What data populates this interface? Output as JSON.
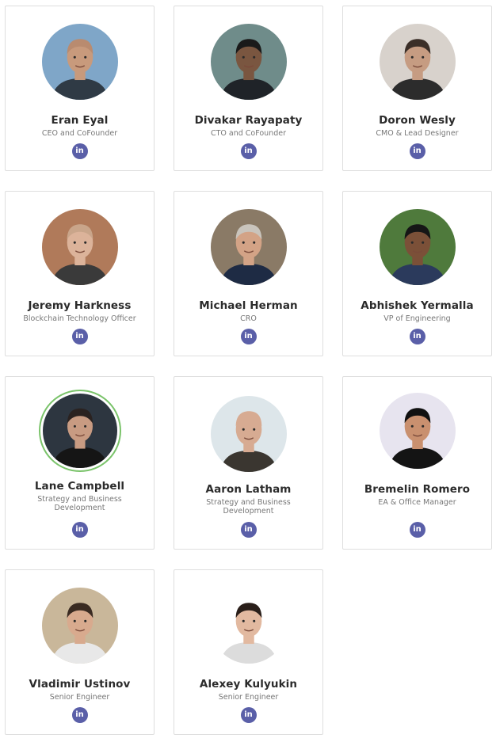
{
  "team": [
    {
      "name": "Eran Eyal",
      "role": "CEO and CoFounder",
      "linkedin_icon": "linkedin-icon",
      "linkedin_glyph": "in",
      "photo": {
        "bg": "#7fa6c8",
        "skin": "#c89a7c",
        "hair": "#b98b6f",
        "shirt": "#2f3a45"
      }
    },
    {
      "name": "Divakar Rayapaty",
      "role": "CTO and CoFounder",
      "linkedin_icon": "linkedin-icon",
      "linkedin_glyph": "in",
      "photo": {
        "bg": "#6f8c8a",
        "skin": "#7a5640",
        "hair": "#1a1a1a",
        "shirt": "#1f2328"
      }
    },
    {
      "name": "Doron Wesly",
      "role": "CMO & Lead Designer",
      "linkedin_icon": "linkedin-icon",
      "linkedin_glyph": "in",
      "photo": {
        "bg": "#d8d2cc",
        "skin": "#c69c82",
        "hair": "#3b2f28",
        "shirt": "#2c2c2c"
      }
    },
    {
      "name": "Jeremy Harkness",
      "role": "Blockchain Technology Officer",
      "linkedin_icon": "linkedin-icon",
      "linkedin_glyph": "in",
      "photo": {
        "bg": "#b07a5a",
        "skin": "#dcb39a",
        "hair": "#c9a58a",
        "shirt": "#3a3a3a"
      }
    },
    {
      "name": "Michael Herman",
      "role": "CRO",
      "linkedin_icon": "linkedin-icon",
      "linkedin_glyph": "in",
      "photo": {
        "bg": "#8a7a66",
        "skin": "#d3a386",
        "hair": "#c9c4bc",
        "shirt": "#1e2b44"
      }
    },
    {
      "name": "Abhishek Yermalla",
      "role": "VP of Engineering",
      "linkedin_icon": "linkedin-icon",
      "linkedin_glyph": "in",
      "photo": {
        "bg": "#4f7a3c",
        "skin": "#7b5038",
        "hair": "#161616",
        "shirt": "#2b3a5c"
      }
    },
    {
      "name": "Lane Campbell",
      "role": "Strategy and Business Development",
      "linkedin_icon": "linkedin-icon",
      "linkedin_glyph": "in",
      "photo": {
        "bg": "#2d3640",
        "skin": "#c89b82",
        "hair": "#2a2220",
        "shirt": "#151515"
      }
    },
    {
      "name": "Aaron Latham",
      "role": "Strategy and Business Development",
      "linkedin_icon": "linkedin-icon",
      "linkedin_glyph": "in",
      "photo": {
        "bg": "#dde6ea",
        "skin": "#d7ab92",
        "hair": "#d7ab92",
        "shirt": "#3a3630"
      }
    },
    {
      "name": "Bremelin Romero",
      "role": "EA & Office Manager",
      "linkedin_icon": "linkedin-icon",
      "linkedin_glyph": "in",
      "photo": {
        "bg": "#e7e4ef",
        "skin": "#c9906f",
        "hair": "#111111",
        "shirt": "#141414"
      }
    },
    {
      "name": "Vladimir Ustinov",
      "role": "Senior Engineer",
      "linkedin_icon": "linkedin-icon",
      "linkedin_glyph": "in",
      "photo": {
        "bg": "#c9b79a",
        "skin": "#d8aa8e",
        "hair": "#3a2b22",
        "shirt": "#e8e8e8"
      }
    },
    {
      "name": "Alexey Kulyukin",
      "role": "Senior Engineer",
      "linkedin_icon": "linkedin-icon",
      "linkedin_glyph": "in",
      "photo": {
        "bg": "#ffffff",
        "skin": "#e2b9a0",
        "hair": "#2a1f1a",
        "shirt": "#dcdcdc"
      }
    }
  ]
}
